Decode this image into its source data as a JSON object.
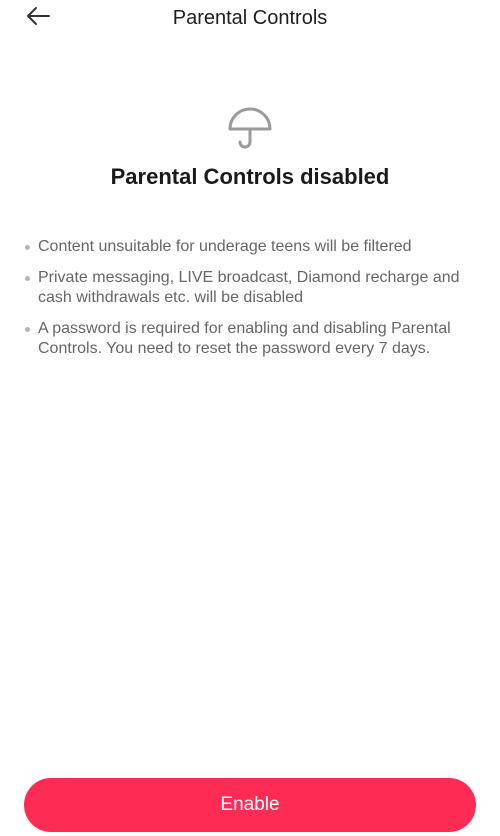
{
  "header": {
    "title": "Parental Controls",
    "back_icon": "arrow-left-icon"
  },
  "hero": {
    "icon": "umbrella-icon",
    "icon_color": "#9a9a9a",
    "status_title": "Parental Controls disabled"
  },
  "info": {
    "items": [
      "Content unsuitable for underage teens will be filtered",
      "Private messaging, LIVE broadcast, Diamond recharge and cash withdrawals etc. will be disabled",
      "A password is required for enabling and disabling Parental Controls. You need to reset the password every 7 days."
    ]
  },
  "actions": {
    "enable_label": "Enable",
    "accent_color": "#fe2c55"
  }
}
